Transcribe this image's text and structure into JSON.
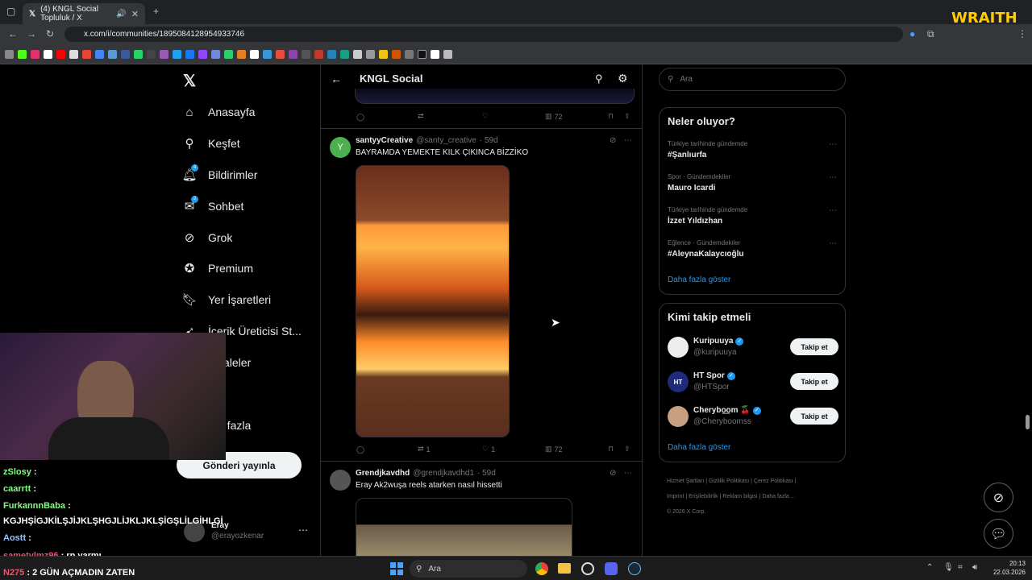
{
  "browser": {
    "tab_title": "(4) KNGL Social Topluluk / X",
    "url": "x.com/i/communities/1895084128954933746"
  },
  "overlay": {
    "logo_text": "WRAITH"
  },
  "nav": {
    "items": [
      {
        "label": "Anasayfa",
        "icon": "home-icon"
      },
      {
        "label": "Keşfet",
        "icon": "search-icon"
      },
      {
        "label": "Bildirimler",
        "icon": "bell-icon",
        "badge": "4"
      },
      {
        "label": "Sohbet",
        "icon": "mail-icon",
        "badge": "2"
      },
      {
        "label": "Grok",
        "icon": "grok-icon"
      },
      {
        "label": "Premium",
        "icon": "premium-icon"
      },
      {
        "label": "Yer İşaretleri",
        "icon": "bookmark-icon"
      },
      {
        "label": "İçerik Üreticisi St...",
        "icon": "creator-icon"
      },
      {
        "label": "kaleler",
        "icon": "article-icon"
      },
      {
        "label": "fil",
        "icon": "profile-icon"
      },
      {
        "label": "a fazla",
        "icon": "more-icon"
      }
    ],
    "post_button": "Gönderi yayınla",
    "account": {
      "name": "Eray",
      "handle": "@erayozkenar"
    }
  },
  "feed": {
    "title": "KNGL Social",
    "top_post": {
      "views": "72"
    },
    "posts": [
      {
        "name": "santyyCreative",
        "handle": "@santy_creative",
        "time": "· 59d",
        "text": "BAYRAMDA YEMEKTE KILK ÇIKINCA BİZZİKO",
        "retweets": "1",
        "likes": "1",
        "views": "72"
      },
      {
        "name": "Grendjkavdhd",
        "handle": "@grendjkavdhd1",
        "time": "· 59d",
        "text": "Eray Ak2wuşa reels atarken nasıl hissetti"
      }
    ]
  },
  "sidebar": {
    "search_placeholder": "Ara",
    "trends": {
      "title": "Neler oluyor?",
      "items": [
        {
          "meta": "Türkiye tarihinde gündemde",
          "name": "#Şanlıurfa"
        },
        {
          "meta": "Spor · Gündemdekiler",
          "name": "Mauro Icardi"
        },
        {
          "meta": "Türkiye tarihinde gündemde",
          "name": "İzzet Yıldızhan"
        },
        {
          "meta": "Eğlence · Gündemdekiler",
          "name": "#AleynaKalaycıoğlu"
        }
      ],
      "show_more": "Daha fazla göster"
    },
    "who_to_follow": {
      "title": "Kimi takip etmeli",
      "button": "Takip et",
      "items": [
        {
          "name": "Kuripuuya",
          "handle": "@kuripuuya"
        },
        {
          "name": "HT Spor",
          "handle": "@HTSpor",
          "avatar_text": "HT"
        },
        {
          "name": "Cherybo͟om 🍒",
          "handle": "@Cheryboomss"
        }
      ],
      "show_more": "Daha fazla göster"
    },
    "footer": [
      "Hizmet Şartları",
      "Gizlilik Politikası",
      "Çerez Politikası",
      "Imprint",
      "Erişilebilirlik",
      "Reklam bilgisi",
      "Daha fazla ...",
      "© 2026 X Corp."
    ]
  },
  "chat": {
    "lines": [
      {
        "user": "zSlosy",
        "msg": ":",
        "color": "#ffffff"
      },
      {
        "user": "caarrtt",
        "msg": ":",
        "color": "#ffffff"
      },
      {
        "user": "FurkannnBaba",
        "msg": ":",
        "color": "#ffffff"
      },
      {
        "user": "",
        "msg": "KGJHŞİGJKİLŞJİJKLŞHGJLİJKLJKLŞİGŞLİLGİHLGİ",
        "color": "#ffffff"
      },
      {
        "user": "Aostt",
        "msg": ":",
        "color": "#ffffff"
      },
      {
        "user": "sametylmz96",
        "msg": ": rp varmı",
        "color": "#ff4d6d"
      },
      {
        "user": "N275",
        "msg": ": 2 GÜN AÇMADIN ZATEN",
        "color": "#ff4d6d"
      }
    ]
  },
  "taskbar": {
    "search": "Ara",
    "time": "20:13",
    "date": "22.03.2026"
  }
}
